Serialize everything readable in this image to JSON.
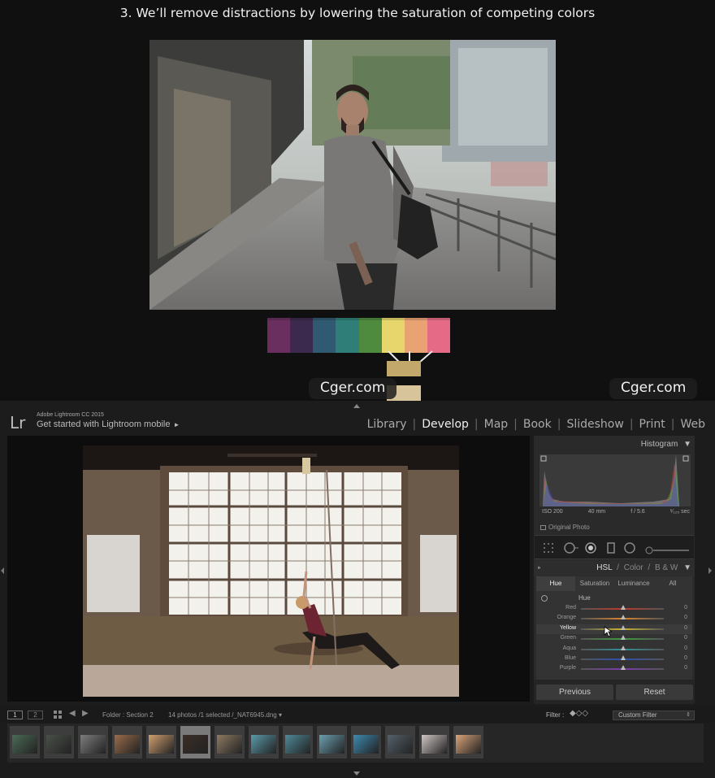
{
  "slide": {
    "title": "3. We’ll remove distractions by lowering the saturation of competing colors",
    "palette": [
      "#6a2f5e",
      "#3b2a4d",
      "#2f5a72",
      "#2f7f78",
      "#4e8b3e",
      "#e6d66c",
      "#e9a272",
      "#e46a85"
    ],
    "result_color": "#c2a86a",
    "result_color_2": "#d8c49a",
    "watermark_left": "Cger.com",
    "watermark_right": "Cger.com"
  },
  "lightroom": {
    "logo": "Lr",
    "app_name": "Adobe Lightroom CC 2015",
    "mobile_label": "Get started with Lightroom mobile",
    "mobile_arrow": "►",
    "modules": [
      "Library",
      "Develop",
      "Map",
      "Book",
      "Slideshow",
      "Print",
      "Web"
    ],
    "active_module": "Develop",
    "histogram": {
      "title": "Histogram",
      "arrow": "▼",
      "iso": "ISO 200",
      "focal": "40 mm",
      "aperture": "f / 5.6",
      "shutter": "¹⁄₁₂₅ sec",
      "original_photo": "Original Photo"
    },
    "hsl": {
      "tab_hsl": "HSL",
      "slash1": "/",
      "tab_color": "Color",
      "slash2": "/",
      "tab_bw": "B & W",
      "arrow": "▼",
      "subtabs": [
        "Hue",
        "Saturation",
        "Luminance",
        "All"
      ],
      "selected_subtab": "Hue",
      "section_label": "Hue",
      "sliders": [
        {
          "name": "Red",
          "value": "0",
          "color": "#c0392b"
        },
        {
          "name": "Orange",
          "value": "0",
          "color": "#d9822b"
        },
        {
          "name": "Yellow",
          "value": "0",
          "color": "#c9b52c"
        },
        {
          "name": "Green",
          "value": "0",
          "color": "#3f9a3f"
        },
        {
          "name": "Aqua",
          "value": "0",
          "color": "#2f8f95"
        },
        {
          "name": "Blue",
          "value": "0",
          "color": "#2c4fb0"
        },
        {
          "name": "Purple",
          "value": "0",
          "color": "#7b3ab0"
        }
      ],
      "highlighted": "Yellow"
    },
    "buttons": {
      "previous": "Previous",
      "reset": "Reset"
    },
    "filmstrip_bar": {
      "screen1": "1",
      "screen2": "2",
      "prev": "◀",
      "next": "▶",
      "folder": "Folder : Section 2",
      "count": "14 photos /1 selected /_NAT6945.dng ▾",
      "filter_label": "Filter :",
      "filter_icons": "◆◇◇",
      "custom_filter": "Custom Filter",
      "custom_arrow": "⇕"
    },
    "thumbnails": [
      {
        "bg": "#4b6a55",
        "selected": false
      },
      {
        "bg": "#4a5048",
        "selected": false
      },
      {
        "bg": "#7d7d7d",
        "selected": false
      },
      {
        "bg": "#9b6b4a",
        "selected": false
      },
      {
        "bg": "#d0a070",
        "selected": false
      },
      {
        "bg": "#3b2e26",
        "selected": true
      },
      {
        "bg": "#8e7a62",
        "selected": false
      },
      {
        "bg": "#5a9aaa",
        "selected": false
      },
      {
        "bg": "#4f8a98",
        "selected": false
      },
      {
        "bg": "#6aa0b0",
        "selected": false
      },
      {
        "bg": "#3d8ab0",
        "selected": false
      },
      {
        "bg": "#55616a",
        "selected": false
      },
      {
        "bg": "#cfc6c4",
        "selected": false
      },
      {
        "bg": "#d9a47a",
        "selected": false
      }
    ]
  }
}
